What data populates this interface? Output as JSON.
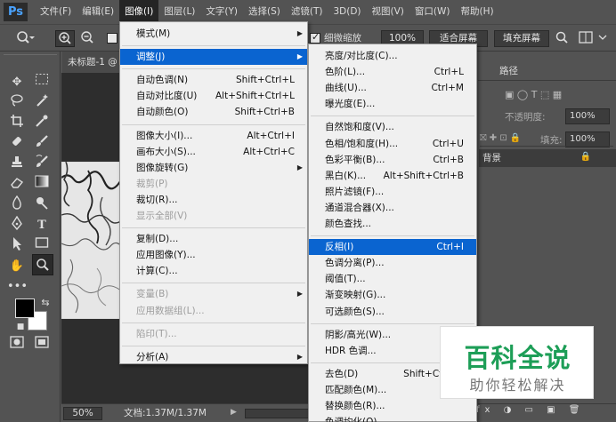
{
  "app": {
    "logo": "Ps"
  },
  "menubar": [
    "文件(F)",
    "编辑(E)",
    "图像(I)",
    "图层(L)",
    "文字(Y)",
    "选择(S)",
    "滤镜(T)",
    "3D(D)",
    "视图(V)",
    "窗口(W)",
    "帮助(H)"
  ],
  "options": {
    "resize_windows_label": "细微缩放",
    "zoom_value": "100%",
    "fit_screen": "适合屏幕",
    "fill_screen": "填充屏幕"
  },
  "document": {
    "tab_title": "未标题-1 @",
    "zoom": "50%",
    "info": "文档:1.37M/1.37M"
  },
  "panels": {
    "tab_paths": "路径",
    "opacity_label": "不透明度:",
    "opacity_value": "100%",
    "fill_label": "填充:",
    "fill_value": "100%",
    "background_layer": "背景"
  },
  "image_menu": [
    {
      "label": "模式(M)",
      "shortcut": "",
      "submenu": true
    },
    {
      "sep": true
    },
    {
      "label": "调整(J)",
      "shortcut": "",
      "submenu": true,
      "highlight": true
    },
    {
      "sep": true
    },
    {
      "label": "自动色调(N)",
      "shortcut": "Shift+Ctrl+L"
    },
    {
      "label": "自动对比度(U)",
      "shortcut": "Alt+Shift+Ctrl+L"
    },
    {
      "label": "自动颜色(O)",
      "shortcut": "Shift+Ctrl+B"
    },
    {
      "sep": true
    },
    {
      "label": "图像大小(I)...",
      "shortcut": "Alt+Ctrl+I"
    },
    {
      "label": "画布大小(S)...",
      "shortcut": "Alt+Ctrl+C"
    },
    {
      "label": "图像旋转(G)",
      "shortcut": "",
      "submenu": true
    },
    {
      "label": "裁剪(P)",
      "shortcut": "",
      "disabled": true
    },
    {
      "label": "裁切(R)...",
      "shortcut": ""
    },
    {
      "label": "显示全部(V)",
      "shortcut": "",
      "disabled": true
    },
    {
      "sep": true
    },
    {
      "label": "复制(D)...",
      "shortcut": ""
    },
    {
      "label": "应用图像(Y)...",
      "shortcut": ""
    },
    {
      "label": "计算(C)...",
      "shortcut": ""
    },
    {
      "sep": true
    },
    {
      "label": "变量(B)",
      "shortcut": "",
      "submenu": true,
      "disabled": true
    },
    {
      "label": "应用数据组(L)...",
      "shortcut": "",
      "disabled": true
    },
    {
      "sep": true
    },
    {
      "label": "陷印(T)...",
      "shortcut": "",
      "disabled": true
    },
    {
      "sep": true
    },
    {
      "label": "分析(A)",
      "shortcut": "",
      "submenu": true
    }
  ],
  "adjust_menu": [
    {
      "label": "亮度/对比度(C)...",
      "shortcut": ""
    },
    {
      "label": "色阶(L)...",
      "shortcut": "Ctrl+L"
    },
    {
      "label": "曲线(U)...",
      "shortcut": "Ctrl+M"
    },
    {
      "label": "曝光度(E)...",
      "shortcut": ""
    },
    {
      "sep": true
    },
    {
      "label": "自然饱和度(V)...",
      "shortcut": ""
    },
    {
      "label": "色相/饱和度(H)...",
      "shortcut": "Ctrl+U"
    },
    {
      "label": "色彩平衡(B)...",
      "shortcut": "Ctrl+B"
    },
    {
      "label": "黑白(K)...",
      "shortcut": "Alt+Shift+Ctrl+B"
    },
    {
      "label": "照片滤镜(F)...",
      "shortcut": ""
    },
    {
      "label": "通道混合器(X)...",
      "shortcut": ""
    },
    {
      "label": "颜色查找...",
      "shortcut": ""
    },
    {
      "sep": true
    },
    {
      "label": "反相(I)",
      "shortcut": "Ctrl+I",
      "highlight": true
    },
    {
      "label": "色调分离(P)...",
      "shortcut": ""
    },
    {
      "label": "阈值(T)...",
      "shortcut": ""
    },
    {
      "label": "渐变映射(G)...",
      "shortcut": ""
    },
    {
      "label": "可选颜色(S)...",
      "shortcut": ""
    },
    {
      "sep": true
    },
    {
      "label": "阴影/高光(W)...",
      "shortcut": ""
    },
    {
      "label": "HDR 色调...",
      "shortcut": ""
    },
    {
      "sep": true
    },
    {
      "label": "去色(D)",
      "shortcut": "Shift+Ctrl+U"
    },
    {
      "label": "匹配颜色(M)...",
      "shortcut": ""
    },
    {
      "label": "替换颜色(R)...",
      "shortcut": ""
    },
    {
      "label": "色调均化(Q)",
      "shortcut": ""
    }
  ],
  "watermark": {
    "title": "百科全说",
    "subtitle": "助你轻松解决"
  }
}
